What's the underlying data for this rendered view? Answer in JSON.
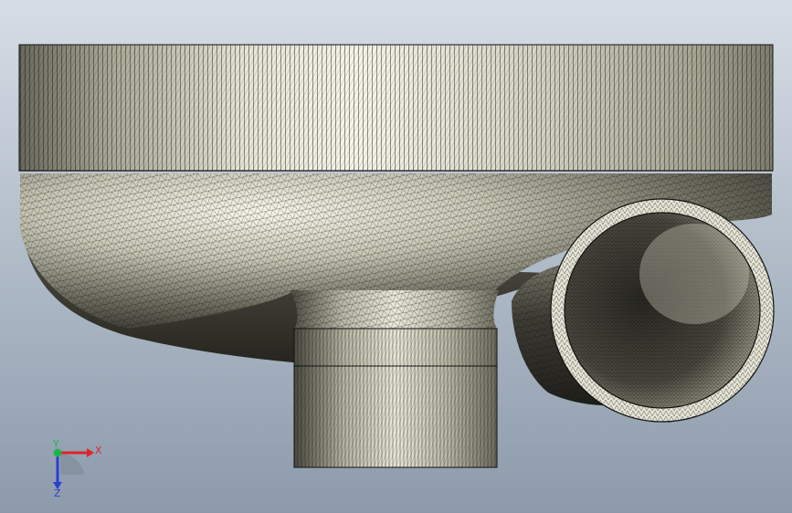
{
  "viewport": {
    "background_top": "#d6dde6",
    "background_bottom": "#8c9aab",
    "model_light": "#f3f2e4",
    "model_mid": "#b9b8a6",
    "model_dark": "#3d3c33",
    "mesh_line": "#111111"
  },
  "triad": {
    "x_label": "X",
    "y_label": "Y",
    "z_label": "Z",
    "x_color": "#e0242b",
    "y_color": "#22b24c",
    "z_color": "#2b3fd1"
  }
}
